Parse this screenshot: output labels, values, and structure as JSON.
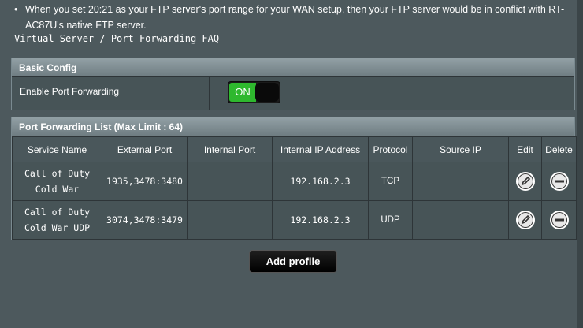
{
  "note": {
    "bullet": "•",
    "text": "When you set 20:21 as your FTP server's port range for your WAN setup, then your FTP server would be in conflict with RT-AC87U's native FTP server."
  },
  "faq_link": "Virtual Server / Port Forwarding FAQ",
  "basic_config": {
    "title": "Basic Config",
    "enable_label": "Enable Port Forwarding",
    "toggle_state": "ON"
  },
  "port_forwarding": {
    "title": "Port Forwarding List (Max Limit : 64)",
    "columns": [
      "Service Name",
      "External Port",
      "Internal Port",
      "Internal IP Address",
      "Protocol",
      "Source IP",
      "Edit",
      "Delete"
    ],
    "rows": [
      {
        "service_line1": "Call of Duty",
        "service_line2": "Cold War",
        "external_port": "1935,3478:3480",
        "internal_port": "",
        "internal_ip": "192.168.2.3",
        "protocol": "TCP",
        "source_ip": ""
      },
      {
        "service_line1": "Call of Duty",
        "service_line2": "Cold War UDP",
        "external_port": "3074,3478:3479",
        "internal_port": "",
        "internal_ip": "192.168.2.3",
        "protocol": "UDP",
        "source_ip": ""
      }
    ],
    "edit_icon": "edit-pencil-icon",
    "delete_icon": "delete-minus-icon"
  },
  "add_profile_label": "Add profile",
  "colors": {
    "background": "#4d595d",
    "header": "#7f8d92",
    "toggle_on": "#2eb82e"
  }
}
